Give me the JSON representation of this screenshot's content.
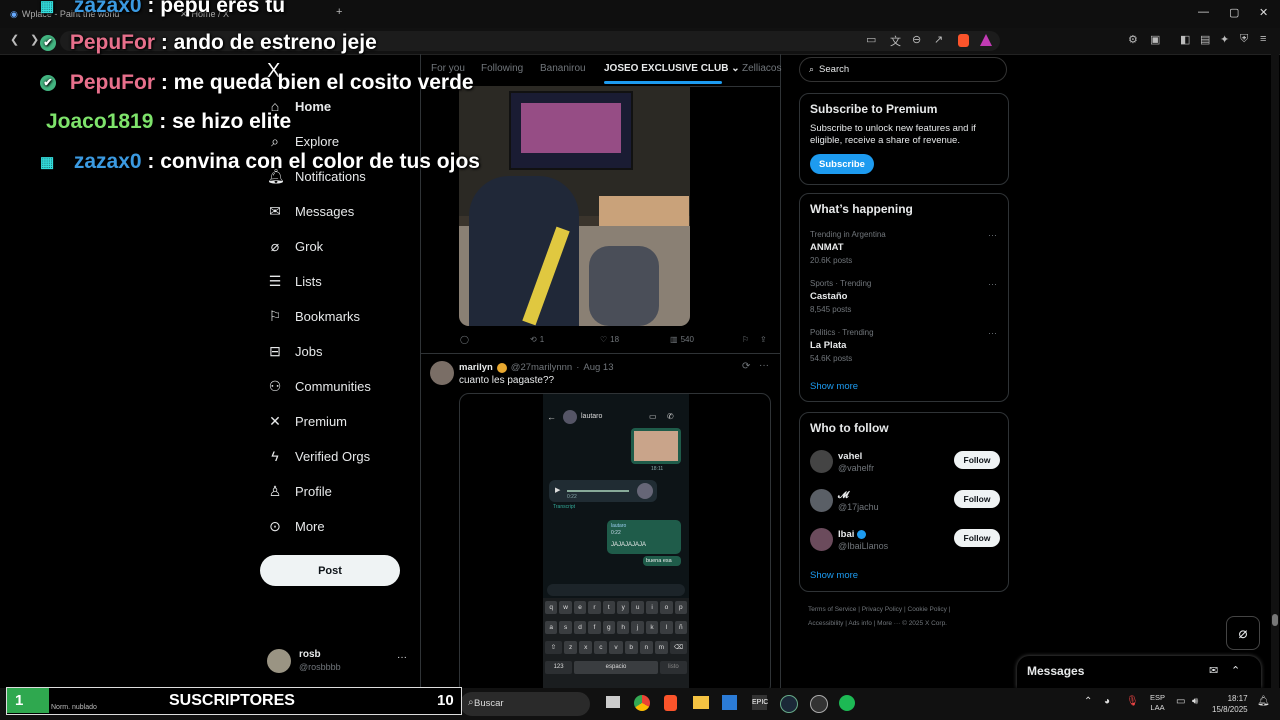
{
  "browser": {
    "tabs": [
      {
        "label": "Wplace - Paint the world"
      },
      {
        "label": "Home / X"
      }
    ]
  },
  "chat_overlay": [
    {
      "user": "zazax0",
      "message": ": pepu eres tu",
      "color": "#3b9ae1",
      "badge": "grid"
    },
    {
      "user": "PepuFor",
      "message": ": ando de estreno jeje",
      "color": "#e8708c",
      "badge": "check"
    },
    {
      "user": "PepuFor",
      "message": ": me queda bien el cosito verde",
      "color": "#e8708c",
      "badge": "check"
    },
    {
      "user": "Joaco1819",
      "message": ": se hizo elite",
      "color": "#7ee36b",
      "badge": ""
    },
    {
      "user": "zazax0",
      "message": ": convina con el color de tus ojos",
      "color": "#3b9ae1",
      "badge": "grid"
    }
  ],
  "sidebar": {
    "logo": "X",
    "items": [
      {
        "label": "Home",
        "icon": "home-icon"
      },
      {
        "label": "Explore",
        "icon": "search-icon"
      },
      {
        "label": "Notifications",
        "icon": "bell-icon"
      },
      {
        "label": "Messages",
        "icon": "mail-icon"
      },
      {
        "label": "Grok",
        "icon": "grok-icon"
      },
      {
        "label": "Lists",
        "icon": "list-icon"
      },
      {
        "label": "Bookmarks",
        "icon": "bookmark-icon"
      },
      {
        "label": "Jobs",
        "icon": "briefcase-icon"
      },
      {
        "label": "Communities",
        "icon": "people-icon"
      },
      {
        "label": "Premium",
        "icon": "x-icon"
      },
      {
        "label": "Verified Orgs",
        "icon": "lightning-icon"
      },
      {
        "label": "Profile",
        "icon": "person-icon"
      },
      {
        "label": "More",
        "icon": "more-circle-icon"
      }
    ],
    "post_label": "Post",
    "account": {
      "name": "rosb",
      "handle": "@rosbbbb"
    }
  },
  "feed": {
    "tabs": [
      "For you",
      "Following",
      "Bananirou",
      "JOSEO EXCLUSIVE CLUB",
      "Zelliacos"
    ],
    "active_tab": "JOSEO EXCLUSIVE CLUB",
    "post1_actions": {
      "replies": "",
      "reposts": "1",
      "likes": "18",
      "views": "540"
    },
    "post2": {
      "author": "marilyn",
      "handle": "@27marilynnn",
      "date": "Aug 13",
      "text": "cuanto les pagaste??"
    },
    "phone_chat": {
      "contact": "lautaro",
      "time1": "18:11",
      "voice_duration": "0:22",
      "transcript_label": "Transcript",
      "bubble_name": "lautaro",
      "bubble_duration": "0:22",
      "bubble_text": "JAJAJAJAJA",
      "reply": "buena esa",
      "keys_row1": [
        "q",
        "w",
        "e",
        "r",
        "t",
        "y",
        "u",
        "i",
        "o",
        "p"
      ],
      "keys_row2": [
        "a",
        "s",
        "d",
        "f",
        "g",
        "h",
        "j",
        "k",
        "l",
        "ñ"
      ],
      "keys_row3": [
        "z",
        "x",
        "c",
        "v",
        "b",
        "n",
        "m"
      ],
      "num_key": "123",
      "space_key": "espacio",
      "enter_key": "listo"
    }
  },
  "right": {
    "search_placeholder": "Search",
    "premium": {
      "title": "Subscribe to Premium",
      "text": "Subscribe to unlock new features and if eligible, receive a share of revenue.",
      "button": "Subscribe"
    },
    "happening": {
      "title": "What’s happening",
      "trends": [
        {
          "meta": "Trending in Argentina",
          "name": "ANMAT",
          "posts": "20.6K posts"
        },
        {
          "meta": "Sports · Trending",
          "name": "Castaño",
          "posts": "8,545 posts"
        },
        {
          "meta": "Politics · Trending",
          "name": "La Plata",
          "posts": "54.6K posts"
        }
      ],
      "show_more": "Show more"
    },
    "who_to_follow": {
      "title": "Who to follow",
      "users": [
        {
          "name": "vahel",
          "handle": "@vahelfr",
          "button": "Follow"
        },
        {
          "name": "𝓜",
          "handle": "@17jachu",
          "button": "Follow"
        },
        {
          "name": "Ibai",
          "handle": "@IbaiLlanos",
          "button": "Follow"
        }
      ],
      "show_more": "Show more"
    },
    "footer": [
      "Terms of Service",
      "Privacy Policy",
      "Cookie Policy",
      "Accessibility",
      "Ads info",
      "More ···",
      "© 2025 X Corp."
    ],
    "messages_label": "Messages"
  },
  "stream_overlay": {
    "count_left": "1",
    "label": "SUSCRIPTORES",
    "count_right": "10",
    "weather": "Norm. nublado"
  },
  "taskbar": {
    "search": "Buscar",
    "lang": "ESP",
    "lang2": "LAA",
    "time": "18:17",
    "date": "15/8/2025"
  },
  "colors": {
    "accent": "#1d9bf0",
    "brand_brave": "#fb542b",
    "spotify": "#1db954"
  }
}
